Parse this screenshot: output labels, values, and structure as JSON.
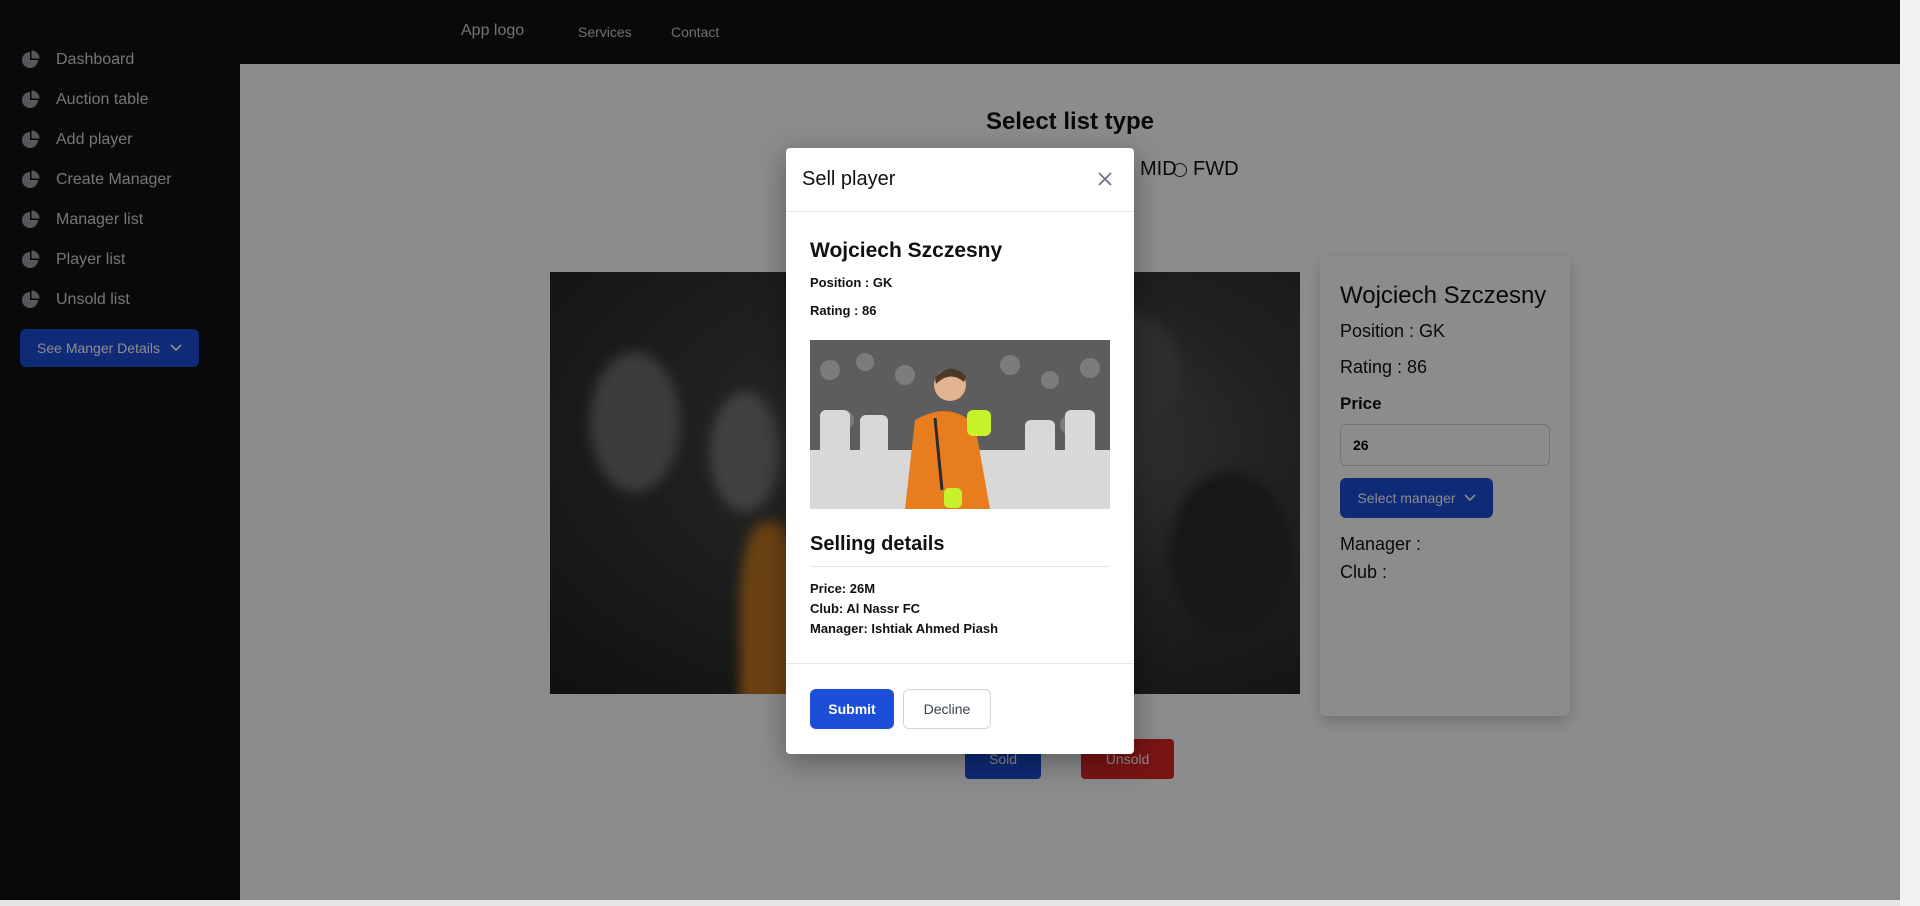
{
  "sidebar": {
    "items": [
      {
        "label": "Dashboard",
        "icon": "pie-chart-icon"
      },
      {
        "label": "Auction table",
        "icon": "pie-chart-icon"
      },
      {
        "label": "Add player",
        "icon": "pie-chart-icon"
      },
      {
        "label": "Create Manager",
        "icon": "pie-chart-icon"
      },
      {
        "label": "Manager list",
        "icon": "pie-chart-icon"
      },
      {
        "label": "Player list",
        "icon": "pie-chart-icon"
      },
      {
        "label": "Unsold list",
        "icon": "pie-chart-icon"
      }
    ],
    "dropdown_label": "See Manger Details"
  },
  "topbar": {
    "logo": "App logo",
    "nav": [
      "Services",
      "Contact"
    ]
  },
  "main": {
    "title": "Select list type",
    "radio_options": [
      "MID",
      "FWD"
    ],
    "card": {
      "name": "Wojciech Szczesny",
      "position": "Position : GK",
      "rating": "Rating : 86",
      "price_label": "Price",
      "price_value": "26",
      "select_manager": "Select manager",
      "manager": "Manager :",
      "club": "Club :"
    },
    "sold_label": "Sold",
    "unsold_label": "Unsold"
  },
  "modal": {
    "title": "Sell player",
    "player_name": "Wojciech Szczesny",
    "position": "Position : GK",
    "rating": "Rating : 86",
    "selling_title": "Selling details",
    "price_line": "Price: 26M",
    "club_line": "Club: Al Nassr FC",
    "manager_line": "Manager: Ishtiak Ahmed Piash",
    "submit": "Submit",
    "decline": "Decline"
  },
  "colors": {
    "accent": "#1d4ed8",
    "danger": "#dc2626",
    "sidebar_bg": "#111213"
  }
}
